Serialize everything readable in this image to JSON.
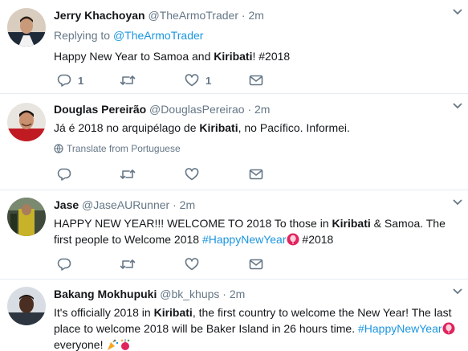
{
  "tweets": [
    {
      "name": "Jerry Khachoyan",
      "handle": "@TheArmoTrader",
      "dot": "·",
      "time": "2m",
      "replying_prefix": "Replying to ",
      "replying_handle": "@TheArmoTrader",
      "text_a": "Happy New Year to Samoa and ",
      "text_bold": "Kiribati",
      "text_b": "! #2018",
      "reply_count": "1",
      "retweet_count": "",
      "like_count": "1"
    },
    {
      "name": "Douglas Pereirão",
      "handle": "@DouglasPereirao",
      "dot": "·",
      "time": "2m",
      "text_a": "Já é 2018 no arquipélago de ",
      "text_bold": "Kiribati",
      "text_b": ", no Pacífico. Informei.",
      "translate": "Translate from Portuguese"
    },
    {
      "name": "Jase",
      "handle": "@JaseAURunner",
      "dot": "·",
      "time": "2m",
      "text_a": "HAPPY NEW YEAR!!! WELCOME TO 2018 To those in ",
      "text_bold": "Kiribati",
      "text_b": " & Samoa. The first people to Welcome 2018 ",
      "hashtag": "#HappyNewYear",
      "text_c": " #2018"
    },
    {
      "name": "Bakang Mokhupuki",
      "handle": "@bk_khups",
      "dot": "·",
      "time": "2m",
      "text_a": "It's officially 2018 in ",
      "text_bold": "Kiribati",
      "text_b": ", the first country to welcome the New Year! The last place to welcome 2018 will be Baker Island in 26 hours time. ",
      "hashtag": "#HappyNewYear",
      "text_c": " everyone! "
    }
  ],
  "icons": {
    "reply": "reply-icon",
    "retweet": "retweet-icon",
    "like": "heart-icon",
    "dm": "envelope-icon",
    "globe": "globe-icon",
    "caret": "chevron-down-icon",
    "hashflag": "balloon-icon",
    "party": "party-popper-icon",
    "confetti": "confetti-ball-icon"
  },
  "colors": {
    "link": "#1b95e0",
    "muted": "#657786",
    "text": "#14171a",
    "divider": "#e6ecf0"
  }
}
